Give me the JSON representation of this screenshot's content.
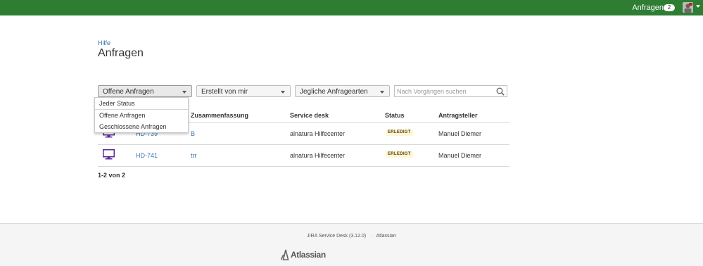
{
  "header": {
    "requests_label": "Anfragen",
    "requests_count": "2",
    "avatar_icon": "user-avatar-icon",
    "bar_color": "#2e7d32"
  },
  "page": {
    "breadcrumb": "Hilfe",
    "title": "Anfragen"
  },
  "filters": {
    "status_selected": "Offene Anfragen",
    "creator_selected": "Erstellt von mir",
    "type_selected": "Jegliche Anfragearten",
    "search_placeholder": "Nach Vorgängen suchen",
    "status_options": [
      "Jeder Status",
      "Offene Anfragen",
      "Geschlossene Anfragen"
    ]
  },
  "table": {
    "columns": {
      "summary": "Zusammenfassung",
      "service_desk": "Service desk",
      "status": "Status",
      "requester": "Antragsteller"
    },
    "rows": [
      {
        "key": "HD-739",
        "summary": "B",
        "service_desk": "alnatura Hilfecenter",
        "status": "ERLEDIGT",
        "requester": "Manuel Diemer",
        "icon": "computer-monitor-icon"
      },
      {
        "key": "HD-741",
        "summary": "trr",
        "service_desk": "alnatura Hilfecenter",
        "status": "ERLEDIGT",
        "requester": "Manuel Diemer",
        "icon": "computer-monitor-icon"
      }
    ],
    "count_label": "1-2 von 2"
  },
  "footer": {
    "product": "JIRA Service Desk (3.12.0)",
    "vendor_link": "Atlassian",
    "logo_text": "Atlassian"
  },
  "colors": {
    "link": "#3572b0",
    "status_lozenge_bg": "#fff6d8",
    "monitor_icon": "#5e2b97"
  }
}
